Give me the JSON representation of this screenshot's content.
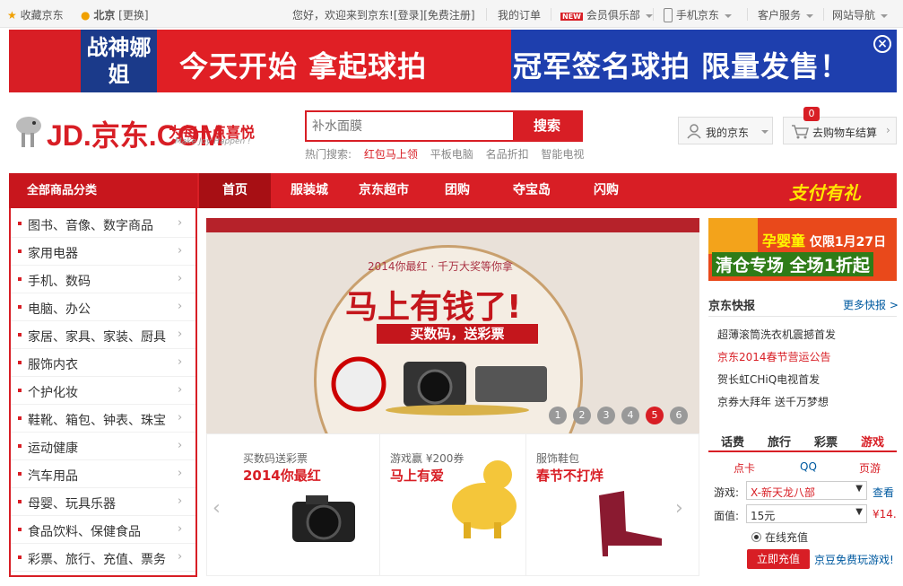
{
  "topbar": {
    "favorite": "收藏京东",
    "location": "北京",
    "change": "[更换]",
    "welcome": "您好，欢迎来到京东!",
    "login": "[登录]",
    "register": "[免费注册]",
    "my_orders": "我的订单",
    "new_badge": "NEW",
    "member_club": "会员俱乐部",
    "mobile_jd": "手机京东",
    "customer_service": "客户服务",
    "site_nav": "网站导航"
  },
  "banner": {
    "left_text": "战神娜姐",
    "headline": "今天开始 拿起球拍",
    "headline2": "冠军签名球拍 限量发售！"
  },
  "header": {
    "logo_text": "JD.京东.COM",
    "slogan": "为每一点喜悦",
    "slogan_en": "Make Joy Happen !",
    "search_placeholder": "补水面膜",
    "search_button": "搜索",
    "hot_label": "热门搜索:",
    "hot_terms": [
      "红包马上领",
      "平板电脑",
      "名品折扣",
      "智能电视"
    ],
    "my_jd": "我的京东",
    "cart_label": "去购物车结算",
    "cart_count": "0"
  },
  "nav": {
    "all_categories": "全部商品分类",
    "items": [
      "首页",
      "服装城",
      "京东超市",
      "团购",
      "夺宝岛",
      "闪购"
    ],
    "promo": "支付有礼"
  },
  "categories": [
    "图书、音像、数字商品",
    "家用电器",
    "手机、数码",
    "电脑、办公",
    "家居、家具、家装、厨具",
    "服饰内衣",
    "个护化妆",
    "鞋靴、箱包、钟表、珠宝",
    "运动健康",
    "汽车用品",
    "母婴、玩具乐器",
    "食品饮料、保健食品",
    "彩票、旅行、充值、票务"
  ],
  "slide": {
    "top_line": "2014你最红 · 千万大奖等你拿",
    "main": "马上有钱了!",
    "sub": "买数码，送彩票",
    "pages": [
      "1",
      "2",
      "3",
      "4",
      "5",
      "6"
    ],
    "active_page": 5
  },
  "products": [
    {
      "caption": "买数码送彩票",
      "headline": "2014你最红"
    },
    {
      "caption": "游戏赢 ¥200券",
      "headline": "马上有爱"
    },
    {
      "caption": "服饰鞋包",
      "headline": "春节不打烊"
    }
  ],
  "right_ad": {
    "brand": "孕婴童",
    "date": "仅限1月27日",
    "slogan": "清仓专场 全场1折起"
  },
  "news": {
    "title": "京东快报",
    "more": "更多快报 >",
    "items": [
      {
        "text": "超薄滚筒洗衣机震撼首发",
        "highlight": false
      },
      {
        "text": "京东2014春节营运公告",
        "highlight": true
      },
      {
        "text": "贺长虹CHiQ电视首发",
        "highlight": false
      },
      {
        "text": "京券大拜年 送千万梦想",
        "highlight": false
      }
    ]
  },
  "recharge": {
    "tabs": [
      "话费",
      "旅行",
      "彩票",
      "游戏"
    ],
    "active_tab": "游戏",
    "subtabs": [
      "点卡",
      "QQ",
      "页游"
    ],
    "game_label": "游戏:",
    "game_value": "X-新天龙八部",
    "game_view": "查看",
    "price_label": "面值:",
    "price_value": "15元",
    "price_amount": "¥14.",
    "radio_label": "在线充值",
    "charge_button": "立即充值",
    "jd_bean": "京豆免费玩游戏!"
  }
}
